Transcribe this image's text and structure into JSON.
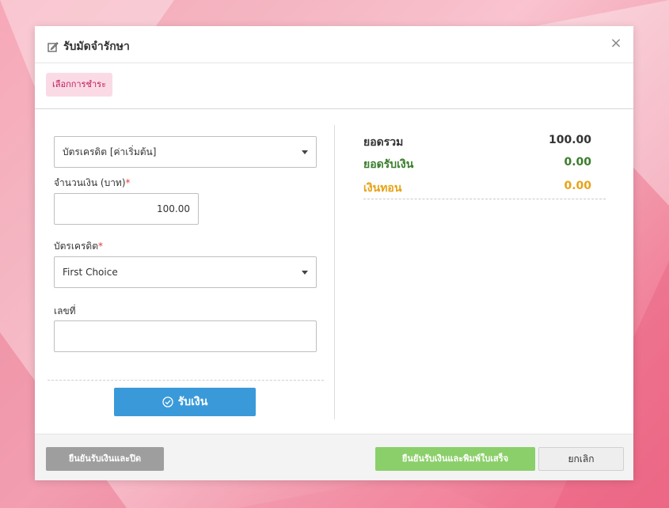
{
  "modal": {
    "title": "รับมัดจำรักษา",
    "title_icon": "edit-icon",
    "close_symbol": "×"
  },
  "tabs": {
    "select_payment": "เลือกการชำระ"
  },
  "form": {
    "payment_type_value": "บัตรเครดิต [ค่าเริ่มต้น]",
    "amount_label": "จำนวนเงิน (บาท)",
    "amount_value": "100.00",
    "required_mark": "*",
    "card_label": "บัตรเครดิต",
    "card_value": "First Choice",
    "number_label": "เลขที่",
    "number_value": "",
    "receive_button": "รับเงิน"
  },
  "summary": {
    "total_label": "ยอดรวม",
    "total_value": "100.00",
    "received_label": "ยอดรับเงิน",
    "received_value": "0.00",
    "change_label": "เงินทอน",
    "change_value": "0.00",
    "colors": {
      "total": "#333333",
      "received": "#3a7d2c",
      "change": "#e6a317"
    }
  },
  "footer": {
    "confirm_close": "ยืนยันรับเงินและปิด",
    "confirm_print": "ยืนยันรับเงินและพิมพ์ใบเสร็จ",
    "cancel": "ยกเลิก"
  },
  "colors": {
    "primary_button": "#3a9ad9",
    "print_button": "#8bcf6a",
    "close_button": "#9e9e9e",
    "tab_bg": "#fadbe5",
    "tab_text": "#c2185b",
    "required": "#e53935"
  }
}
